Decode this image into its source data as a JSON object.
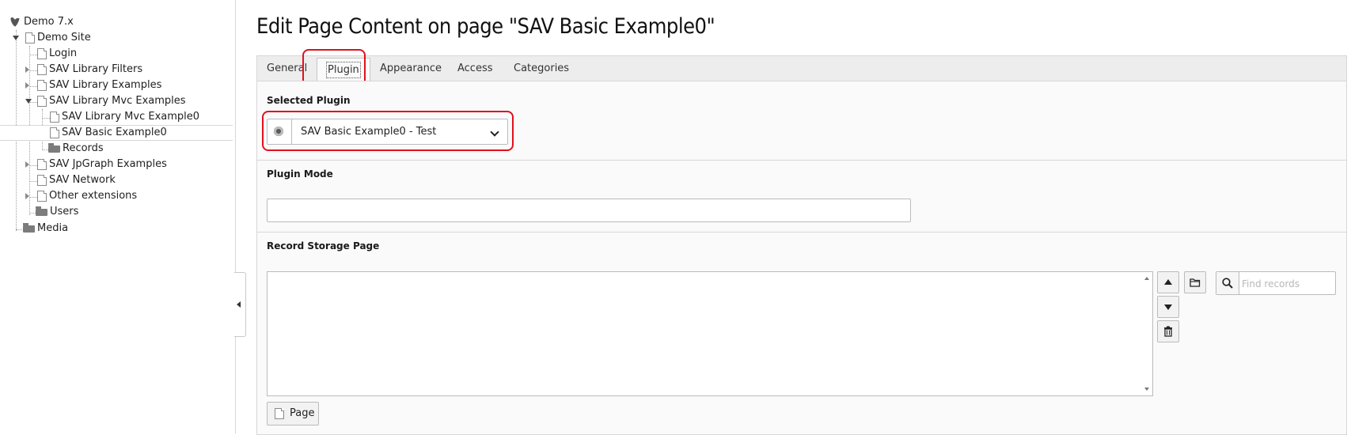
{
  "tree": {
    "root": "Demo 7.x",
    "items": [
      {
        "label": "Demo Site"
      },
      {
        "label": "Login"
      },
      {
        "label": "SAV Library Filters"
      },
      {
        "label": "SAV Library Examples"
      },
      {
        "label": "SAV Library Mvc Examples"
      },
      {
        "label": "SAV Library Mvc Example0"
      },
      {
        "label": "SAV Basic Example0"
      },
      {
        "label": "Records"
      },
      {
        "label": "SAV JpGraph Examples"
      },
      {
        "label": "SAV Network"
      },
      {
        "label": "Other extensions"
      },
      {
        "label": "Users"
      },
      {
        "label": "Media"
      }
    ]
  },
  "header": {
    "title": "Edit Page Content on page \"SAV Basic Example0\""
  },
  "tabs": [
    {
      "label": "General"
    },
    {
      "label": "Plugin"
    },
    {
      "label": "Appearance"
    },
    {
      "label": "Access"
    },
    {
      "label": "Categories"
    }
  ],
  "active_tab": "Plugin",
  "fields": {
    "selected_plugin_label": "Selected Plugin",
    "selected_plugin_value": "SAV Basic Example0 - Test",
    "plugin_mode_label": "Plugin Mode",
    "plugin_mode_value": "",
    "record_storage_label": "Record Storage Page",
    "find_records_placeholder": "Find records",
    "page_button_label": "Page"
  },
  "colors": {
    "highlight": "#e0101e",
    "panel_bg": "#fafafa",
    "tabbar_bg": "#ededed"
  }
}
